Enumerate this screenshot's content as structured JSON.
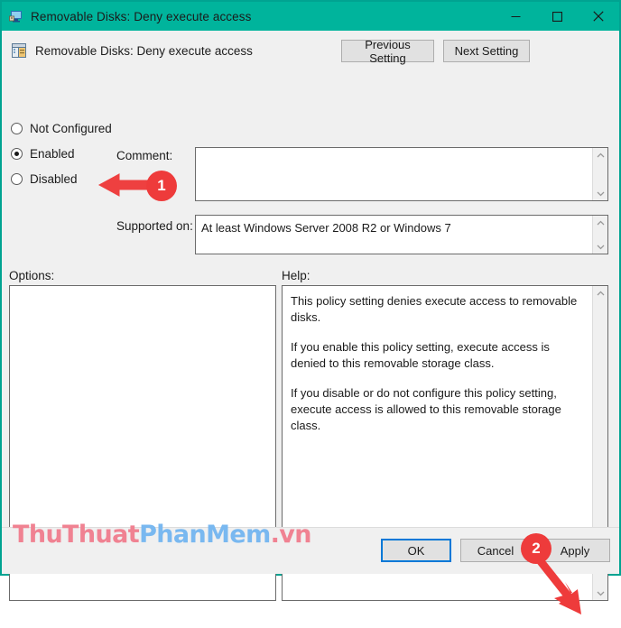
{
  "window": {
    "title": "Removable Disks: Deny execute access",
    "title_icon": "computer-monitor-icon",
    "accent_color": "#00B49C",
    "minimize_label": "Minimize",
    "maximize_label": "Maximize",
    "close_label": "Close"
  },
  "header": {
    "icon": "policy-setting-icon",
    "title": "Removable Disks: Deny execute access",
    "previous_setting_label": "Previous Setting",
    "next_setting_label": "Next Setting"
  },
  "state_options": {
    "items": [
      {
        "label": "Not Configured",
        "selected": false
      },
      {
        "label": "Enabled",
        "selected": true
      },
      {
        "label": "Disabled",
        "selected": false
      }
    ]
  },
  "comment": {
    "label": "Comment:",
    "value": "",
    "placeholder": ""
  },
  "supported_on": {
    "label": "Supported on:",
    "value": "At least Windows Server 2008 R2 or Windows 7"
  },
  "options": {
    "label": "Options:",
    "content": ""
  },
  "help": {
    "label": "Help:",
    "paragraphs": [
      "This policy setting denies execute access to removable disks.",
      "If you enable this policy setting, execute access is denied to this removable storage class.",
      "If you disable or do not configure this policy setting, execute access is allowed to this removable storage class."
    ],
    "paragraph_1": "This policy setting denies execute access to removable disks.",
    "paragraph_2": "If you enable this policy setting, execute access is denied to this removable storage class.",
    "paragraph_3": "If you disable or do not configure this policy setting, execute access is allowed to this removable storage class."
  },
  "footer": {
    "ok_label": "OK",
    "cancel_label": "Cancel",
    "apply_label": "Apply"
  },
  "watermark": {
    "part1": "ThuThuat",
    "part2": "PhanMem",
    "part3": ".vn",
    "color_pink": "#F08292",
    "color_blue": "#79B8F0"
  },
  "annotations": {
    "color": "#EE3B3B",
    "marker_1": "1",
    "marker_2": "2"
  }
}
